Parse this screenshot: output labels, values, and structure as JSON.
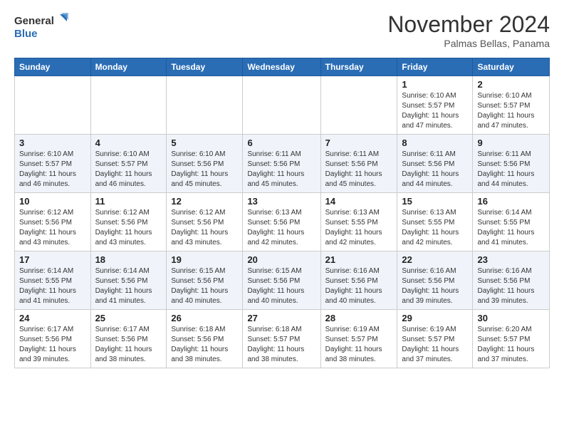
{
  "header": {
    "logo_line1": "General",
    "logo_line2": "Blue",
    "month": "November 2024",
    "location": "Palmas Bellas, Panama"
  },
  "weekdays": [
    "Sunday",
    "Monday",
    "Tuesday",
    "Wednesday",
    "Thursday",
    "Friday",
    "Saturday"
  ],
  "weeks": [
    [
      {
        "day": "",
        "info": ""
      },
      {
        "day": "",
        "info": ""
      },
      {
        "day": "",
        "info": ""
      },
      {
        "day": "",
        "info": ""
      },
      {
        "day": "",
        "info": ""
      },
      {
        "day": "1",
        "info": "Sunrise: 6:10 AM\nSunset: 5:57 PM\nDaylight: 11 hours\nand 47 minutes."
      },
      {
        "day": "2",
        "info": "Sunrise: 6:10 AM\nSunset: 5:57 PM\nDaylight: 11 hours\nand 47 minutes."
      }
    ],
    [
      {
        "day": "3",
        "info": "Sunrise: 6:10 AM\nSunset: 5:57 PM\nDaylight: 11 hours\nand 46 minutes."
      },
      {
        "day": "4",
        "info": "Sunrise: 6:10 AM\nSunset: 5:57 PM\nDaylight: 11 hours\nand 46 minutes."
      },
      {
        "day": "5",
        "info": "Sunrise: 6:10 AM\nSunset: 5:56 PM\nDaylight: 11 hours\nand 45 minutes."
      },
      {
        "day": "6",
        "info": "Sunrise: 6:11 AM\nSunset: 5:56 PM\nDaylight: 11 hours\nand 45 minutes."
      },
      {
        "day": "7",
        "info": "Sunrise: 6:11 AM\nSunset: 5:56 PM\nDaylight: 11 hours\nand 45 minutes."
      },
      {
        "day": "8",
        "info": "Sunrise: 6:11 AM\nSunset: 5:56 PM\nDaylight: 11 hours\nand 44 minutes."
      },
      {
        "day": "9",
        "info": "Sunrise: 6:11 AM\nSunset: 5:56 PM\nDaylight: 11 hours\nand 44 minutes."
      }
    ],
    [
      {
        "day": "10",
        "info": "Sunrise: 6:12 AM\nSunset: 5:56 PM\nDaylight: 11 hours\nand 43 minutes."
      },
      {
        "day": "11",
        "info": "Sunrise: 6:12 AM\nSunset: 5:56 PM\nDaylight: 11 hours\nand 43 minutes."
      },
      {
        "day": "12",
        "info": "Sunrise: 6:12 AM\nSunset: 5:56 PM\nDaylight: 11 hours\nand 43 minutes."
      },
      {
        "day": "13",
        "info": "Sunrise: 6:13 AM\nSunset: 5:56 PM\nDaylight: 11 hours\nand 42 minutes."
      },
      {
        "day": "14",
        "info": "Sunrise: 6:13 AM\nSunset: 5:55 PM\nDaylight: 11 hours\nand 42 minutes."
      },
      {
        "day": "15",
        "info": "Sunrise: 6:13 AM\nSunset: 5:55 PM\nDaylight: 11 hours\nand 42 minutes."
      },
      {
        "day": "16",
        "info": "Sunrise: 6:14 AM\nSunset: 5:55 PM\nDaylight: 11 hours\nand 41 minutes."
      }
    ],
    [
      {
        "day": "17",
        "info": "Sunrise: 6:14 AM\nSunset: 5:55 PM\nDaylight: 11 hours\nand 41 minutes."
      },
      {
        "day": "18",
        "info": "Sunrise: 6:14 AM\nSunset: 5:56 PM\nDaylight: 11 hours\nand 41 minutes."
      },
      {
        "day": "19",
        "info": "Sunrise: 6:15 AM\nSunset: 5:56 PM\nDaylight: 11 hours\nand 40 minutes."
      },
      {
        "day": "20",
        "info": "Sunrise: 6:15 AM\nSunset: 5:56 PM\nDaylight: 11 hours\nand 40 minutes."
      },
      {
        "day": "21",
        "info": "Sunrise: 6:16 AM\nSunset: 5:56 PM\nDaylight: 11 hours\nand 40 minutes."
      },
      {
        "day": "22",
        "info": "Sunrise: 6:16 AM\nSunset: 5:56 PM\nDaylight: 11 hours\nand 39 minutes."
      },
      {
        "day": "23",
        "info": "Sunrise: 6:16 AM\nSunset: 5:56 PM\nDaylight: 11 hours\nand 39 minutes."
      }
    ],
    [
      {
        "day": "24",
        "info": "Sunrise: 6:17 AM\nSunset: 5:56 PM\nDaylight: 11 hours\nand 39 minutes."
      },
      {
        "day": "25",
        "info": "Sunrise: 6:17 AM\nSunset: 5:56 PM\nDaylight: 11 hours\nand 38 minutes."
      },
      {
        "day": "26",
        "info": "Sunrise: 6:18 AM\nSunset: 5:56 PM\nDaylight: 11 hours\nand 38 minutes."
      },
      {
        "day": "27",
        "info": "Sunrise: 6:18 AM\nSunset: 5:57 PM\nDaylight: 11 hours\nand 38 minutes."
      },
      {
        "day": "28",
        "info": "Sunrise: 6:19 AM\nSunset: 5:57 PM\nDaylight: 11 hours\nand 38 minutes."
      },
      {
        "day": "29",
        "info": "Sunrise: 6:19 AM\nSunset: 5:57 PM\nDaylight: 11 hours\nand 37 minutes."
      },
      {
        "day": "30",
        "info": "Sunrise: 6:20 AM\nSunset: 5:57 PM\nDaylight: 11 hours\nand 37 minutes."
      }
    ]
  ]
}
